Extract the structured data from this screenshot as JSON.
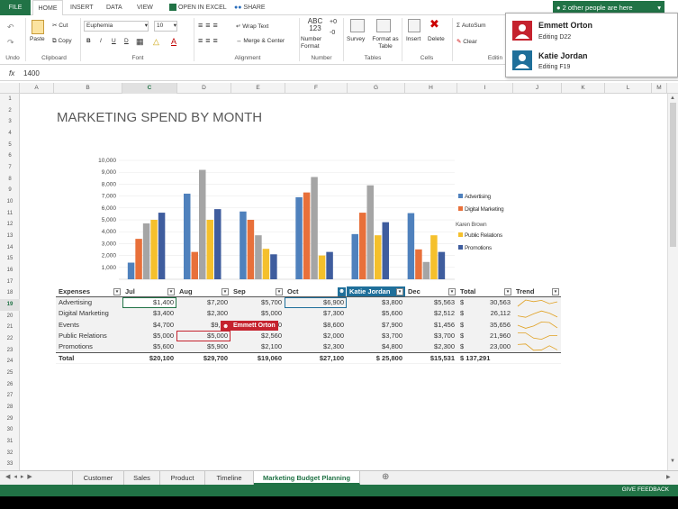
{
  "tabs": {
    "file": "FILE",
    "home": "HOME",
    "insert": "INSERT",
    "data": "DATA",
    "view": "VIEW",
    "open_excel": "OPEN IN EXCEL",
    "share": "SHARE"
  },
  "share_pill": "2 other people are here",
  "ribbon": {
    "undo": "Undo",
    "paste": "Paste",
    "cut": "Cut",
    "copy": "Copy",
    "clipboard": "Clipboard",
    "font_name": "Euphemia",
    "font_size": "10",
    "font": "Font",
    "bold": "B",
    "italic": "I",
    "underline": "U",
    "double_underline": "D",
    "wrap_text": "Wrap Text",
    "merge_center": "Merge & Center",
    "alignment": "Alignment",
    "number_format_label": "Number Format",
    "number_icon": "ABC 123",
    "number": "Number",
    "survey": "Survey",
    "format_table": "Format as Table",
    "tables": "Tables",
    "insert": "Insert",
    "delete": "Delete",
    "cells": "Cells",
    "autosum": "AutoSum",
    "clear": "Clear",
    "editing": "Editin"
  },
  "formula": {
    "fx": "fx",
    "value": "1400"
  },
  "columns": [
    "A",
    "B",
    "C",
    "D",
    "E",
    "F",
    "G",
    "H",
    "I",
    "J",
    "K",
    "L",
    "M"
  ],
  "rows": [
    "1",
    "2",
    "3",
    "4",
    "5",
    "6",
    "7",
    "8",
    "9",
    "10",
    "11",
    "12",
    "13",
    "14",
    "15",
    "16",
    "17",
    "18",
    "19",
    "20",
    "21",
    "22",
    "23",
    "24",
    "25",
    "26",
    "27",
    "28",
    "29",
    "30",
    "31",
    "32",
    "33"
  ],
  "chart_title": "MARKETING SPEND BY MONTH",
  "chart_data": {
    "type": "bar",
    "categories": [
      "Jul",
      "Aug",
      "Sep",
      "Oct",
      "Katie Jordan",
      "Dec"
    ],
    "ylim": [
      0,
      10000
    ],
    "yticks": [
      "1,000",
      "2,000",
      "3,000",
      "4,000",
      "5,000",
      "6,000",
      "7,000",
      "8,000",
      "9,000",
      "10,000"
    ],
    "series": [
      {
        "name": "Advertising",
        "color": "#4f81bd",
        "values": [
          1400,
          7200,
          5700,
          6900,
          3800,
          5563
        ]
      },
      {
        "name": "Digital Marketing",
        "color": "#e8703a",
        "values": [
          3400,
          2300,
          5000,
          7300,
          5600,
          2512
        ]
      },
      {
        "name": "Events",
        "color": "#a5a5a5",
        "values": [
          4700,
          9200,
          3700,
          8600,
          7900,
          1456
        ]
      },
      {
        "name": "Public Relations",
        "color": "#f5c02c",
        "values": [
          5000,
          5000,
          2560,
          2000,
          3700,
          3700
        ]
      },
      {
        "name": "Promotions",
        "color": "#3f5d9e",
        "values": [
          5600,
          5900,
          2100,
          2300,
          4800,
          2300
        ]
      }
    ]
  },
  "legend_extra": "Karen Brown",
  "table": {
    "headers": [
      "Expenses",
      "Jul",
      "Aug",
      "Sep",
      "Oct",
      "Katie Jordan",
      "Dec",
      "Total",
      "Trend"
    ],
    "rows": [
      {
        "label": "Advertising",
        "vals": [
          "$1,400",
          "$7,200",
          "$5,700",
          "$6,900",
          "$3,800",
          "$5,563"
        ],
        "total": "30,563"
      },
      {
        "label": "Digital Marketing",
        "vals": [
          "$3,400",
          "$2,300",
          "$5,000",
          "$7,300",
          "$5,600",
          "$2,512"
        ],
        "total": "26,112"
      },
      {
        "label": "Events",
        "vals": [
          "$4,700",
          "$9,20",
          "$3,700",
          "$8,600",
          "$7,900",
          "$1,456"
        ],
        "total": "35,656"
      },
      {
        "label": "Public Relations",
        "vals": [
          "$5,000",
          "$5,000",
          "$2,560",
          "$2,000",
          "$3,700",
          "$3,700"
        ],
        "total": "21,960"
      },
      {
        "label": "Promotions",
        "vals": [
          "$5,600",
          "$5,900",
          "$2,100",
          "$2,300",
          "$4,800",
          "$2,300"
        ],
        "total": "23,000"
      }
    ],
    "total_row": {
      "label": "Total",
      "vals": [
        "$20,100",
        "$29,700",
        "$19,060",
        "$27,100",
        "$ 25,800",
        "$15,531"
      ],
      "total": "$ 137,291"
    },
    "dollar": "$"
  },
  "cursor_tag": "Emmett Orton",
  "presence": [
    {
      "name": "Emmett Orton",
      "editing": "Editing D22",
      "color": "#c5222e"
    },
    {
      "name": "Katie Jordan",
      "editing": "Editing F19",
      "color": "#1f6f9a"
    }
  ],
  "sheets": [
    "Customer",
    "Sales",
    "Product",
    "Timeline",
    "Marketing Budget Planning"
  ],
  "status": "GIVE FEEDBACK"
}
